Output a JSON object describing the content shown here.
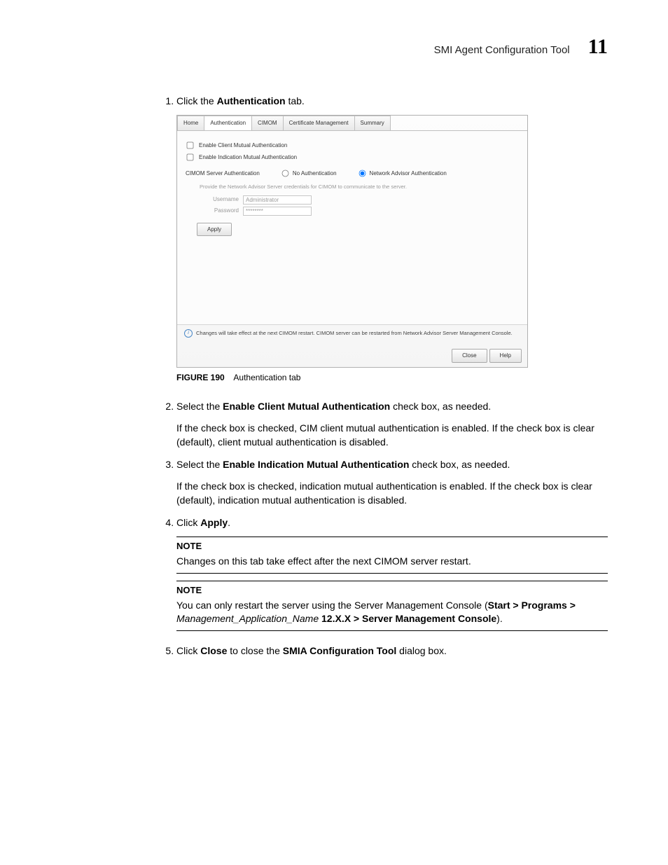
{
  "header": {
    "title": "SMI Agent Configuration Tool",
    "page_number": "11"
  },
  "steps": {
    "s1": {
      "pre": "Click the ",
      "bold": "Authentication",
      "post": " tab."
    },
    "s2": {
      "pre": "Select the ",
      "bold": "Enable Client Mutual Authentication",
      "post": " check box, as needed.",
      "body": "If the check box is checked, CIM client mutual authentication is enabled. If the check box is clear (default), client mutual authentication is disabled."
    },
    "s3": {
      "pre": "Select the ",
      "bold": "Enable Indication Mutual Authentication",
      "post": " check box, as needed.",
      "body": "If the check box is checked, indication mutual authentication is enabled. If the check box is clear (default), indication mutual authentication is disabled."
    },
    "s4": {
      "pre": "Click ",
      "bold": "Apply",
      "post": "."
    },
    "s5": {
      "pre": "Click ",
      "b1": "Close",
      "mid": " to close the ",
      "b2": "SMIA Configuration Tool",
      "post": " dialog box."
    }
  },
  "screenshot": {
    "tabs": {
      "t0": "Home",
      "t1": "Authentication",
      "t2": "CIMOM",
      "t3": "Certificate Management",
      "t4": "Summary"
    },
    "chk1": "Enable Client Mutual Authentication",
    "chk2": "Enable Indication Mutual Authentication",
    "auth_label": "CIMOM Server Authentication",
    "radio_none": "No Authentication",
    "radio_net": "Network Advisor Authentication",
    "cred_hint": "Provide the Network Advisor Server credentials for CIMOM to communicate to the server.",
    "user_label": "Username",
    "user_value": "Administrator",
    "pass_label": "Password",
    "pass_value": "********",
    "apply_btn": "Apply",
    "footer": "Changes will take effect at the next CIMOM restart. CIMOM server can be restarted from Network Advisor Server Management Console.",
    "close_btn": "Close",
    "help_btn": "Help"
  },
  "figure": {
    "label": "FIGURE 190",
    "caption": "Authentication tab"
  },
  "notes": {
    "head": "NOTE",
    "n1": "Changes on this tab take effect after the next CIMOM server restart.",
    "n2_a": "You can only restart the server using the Server Management Console (",
    "n2_b": "Start > Programs > ",
    "n2_c": "Management_Application_Name",
    "n2_d": " 12.X.X > Server Management Console",
    "n2_e": ")."
  }
}
